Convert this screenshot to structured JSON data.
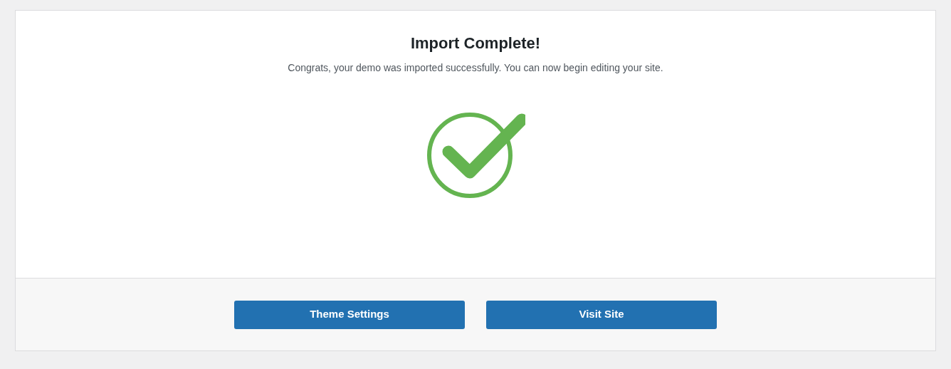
{
  "title": "Import Complete!",
  "message": "Congrats, your demo was imported successfully. You can now begin editing your site.",
  "buttons": [
    "Theme Settings",
    "Visit Site"
  ]
}
